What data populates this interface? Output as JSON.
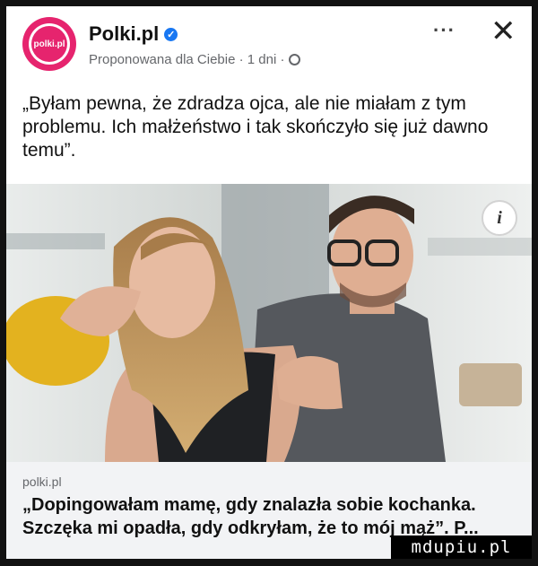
{
  "header": {
    "page_name": "Polki.pl",
    "avatar_text": "polki.pl",
    "meta": "Proponowana dla Ciebie · 1 dni ·",
    "more_label": "···",
    "close_label": "✕"
  },
  "post": {
    "text": "„Byłam pewna, że zdradza ojca, ale nie miałam z tym problemu. Ich małżeństwo i tak skończyło się już dawno temu”."
  },
  "photo": {
    "info_label": "i"
  },
  "link": {
    "domain": "polki.pl",
    "title": "„Dopingowałam mamę, gdy znalazła sobie kochanka. Szczęka mi opadła, gdy odkryłam, że to mój mąż”. P..."
  },
  "watermark": "mdupiu.pl",
  "colors": {
    "brand": "#e6246e",
    "verified": "#1877f2",
    "link_bg": "#f2f3f5"
  }
}
